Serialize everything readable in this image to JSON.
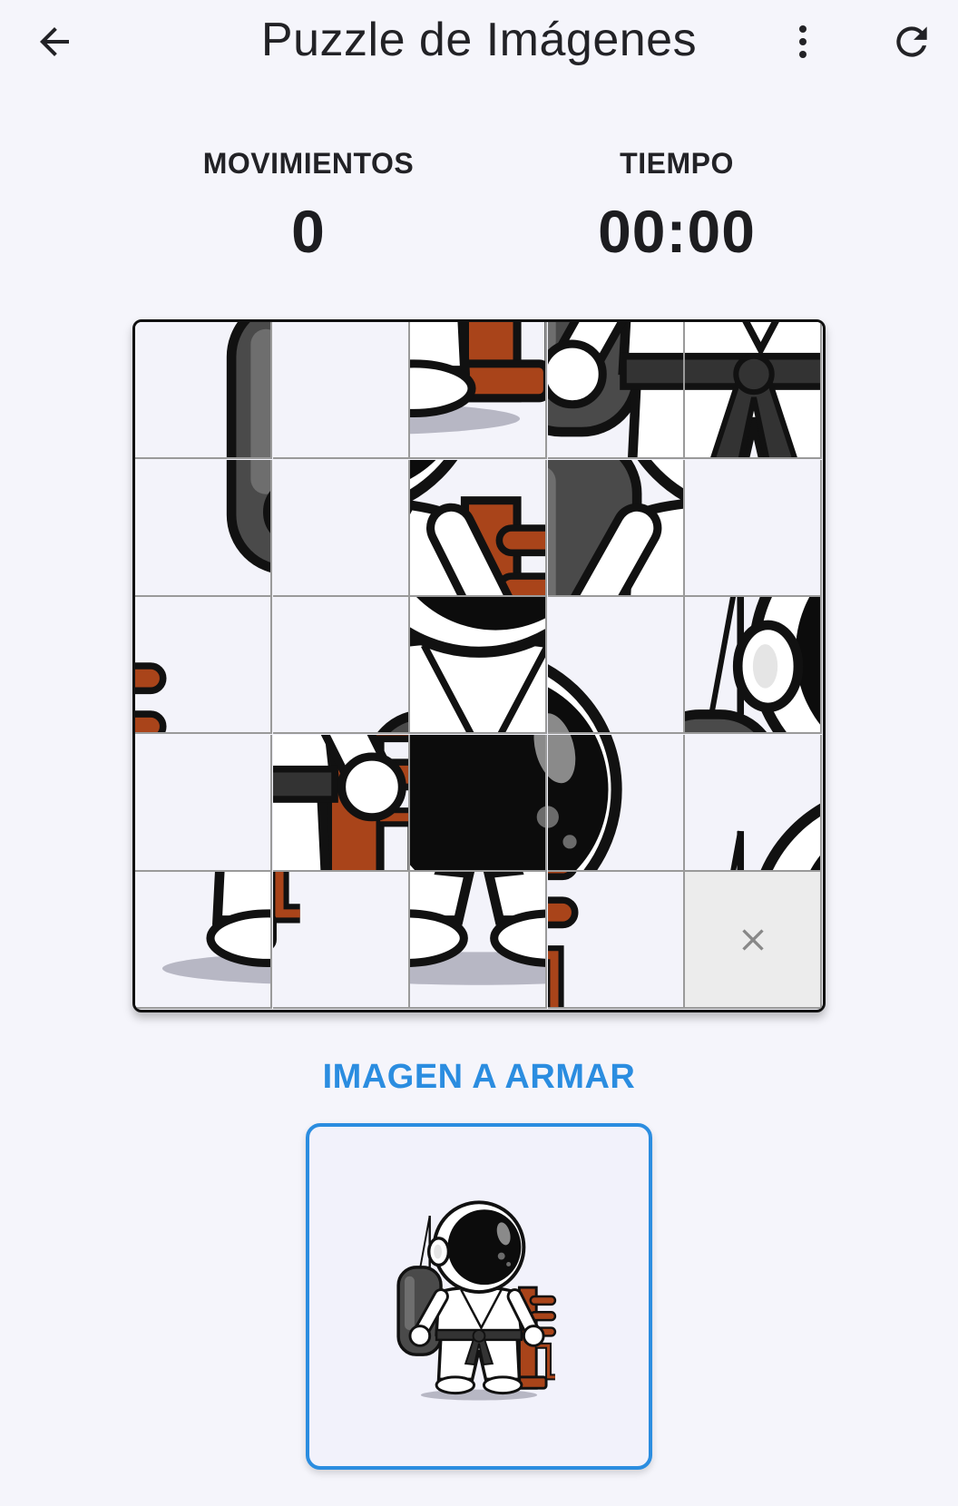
{
  "app_bar": {
    "title": "Puzzle de Imágenes",
    "back_icon": "arrow-back-icon",
    "menu_icon": "more-vert-icon",
    "refresh_icon": "refresh-icon"
  },
  "stats": {
    "moves_label": "MOVIMIENTOS",
    "moves_value": "0",
    "time_label": "TIEMPO",
    "time_value": "00:00"
  },
  "board": {
    "grid_size": 5,
    "empty_tile_icon": "close-icon",
    "tiles": [
      {
        "row": 0,
        "col": 0,
        "src": 10
      },
      {
        "row": 0,
        "col": 1,
        "src": 0
      },
      {
        "row": 0,
        "col": 2,
        "src": 23
      },
      {
        "row": 0,
        "col": 3,
        "src": 16
      },
      {
        "row": 0,
        "col": 4,
        "src": 17
      },
      {
        "row": 1,
        "col": 0,
        "src": 15
      },
      {
        "row": 1,
        "col": 1,
        "src": 20
      },
      {
        "row": 1,
        "col": 2,
        "src": 13
      },
      {
        "row": 1,
        "col": 3,
        "src": 11
      },
      {
        "row": 1,
        "col": 4,
        "src": 4
      },
      {
        "row": 2,
        "col": 0,
        "src": 14
      },
      {
        "row": 2,
        "col": 1,
        "src": 5
      },
      {
        "row": 2,
        "col": 2,
        "src": 12
      },
      {
        "row": 2,
        "col": 3,
        "src": 3
      },
      {
        "row": 2,
        "col": 4,
        "src": 6
      },
      {
        "row": 3,
        "col": 0,
        "src": 9
      },
      {
        "row": 3,
        "col": 1,
        "src": 18
      },
      {
        "row": 3,
        "col": 2,
        "src": 7
      },
      {
        "row": 3,
        "col": 3,
        "src": 8
      },
      {
        "row": 3,
        "col": 4,
        "src": 1
      },
      {
        "row": 4,
        "col": 0,
        "src": 21
      },
      {
        "row": 4,
        "col": 1,
        "src": 24
      },
      {
        "row": 4,
        "col": 2,
        "src": 22
      },
      {
        "row": 4,
        "col": 3,
        "src": 19
      },
      {
        "row": 4,
        "col": 4,
        "src": -1
      }
    ]
  },
  "target": {
    "label": "IMAGEN A ARMAR"
  },
  "colors": {
    "accent": "#2b8de0",
    "background": "#f5f5fb",
    "wood": "#a9441a",
    "bag": "#4a4a4a"
  }
}
